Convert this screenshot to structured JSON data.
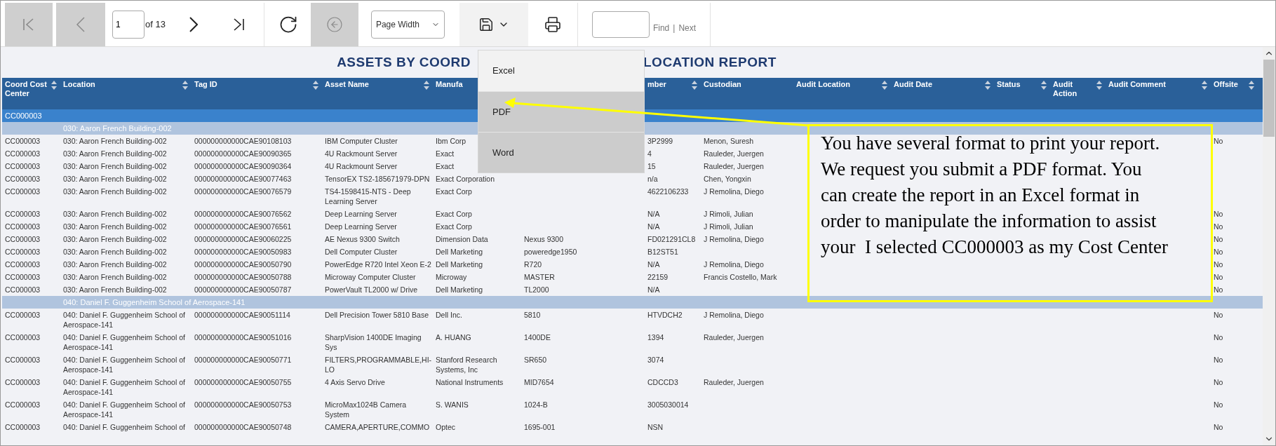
{
  "toolbar": {
    "first_page": {
      "disabled": true
    },
    "previous_page": {
      "disabled": true
    },
    "page_input": {
      "value": "1"
    },
    "page_count": "of 13",
    "next_page": {
      "disabled": false
    },
    "last_page": {
      "disabled": false
    },
    "back": {
      "disabled": true
    },
    "zoom_select": {
      "value": "Page Width"
    },
    "export": {
      "open": true
    },
    "find_link": "Find",
    "separator": "|",
    "next_link": "Next"
  },
  "export_menu": [
    {
      "label": "Excel",
      "highlighted": true
    },
    {
      "label": "PDF",
      "highlighted": false
    },
    {
      "label": "Word",
      "highlighted": false
    }
  ],
  "report_title": {
    "left_part": "ASSETS BY COORD",
    "right_part": "LOCATION REPORT"
  },
  "columns": [
    {
      "label": "Coord Cost Center",
      "sortable": true
    },
    {
      "label": "Location",
      "sortable": true
    },
    {
      "label": "Tag ID",
      "sortable": true
    },
    {
      "label": "Asset Name",
      "sortable": true
    },
    {
      "label": "Manufa",
      "sortable": false
    },
    {},
    {
      "label": "mber",
      "sortable": true
    },
    {
      "label": "Custodian",
      "sortable": false
    },
    {
      "label": "Audit Location",
      "sortable": true
    },
    {
      "label": "Audit Date",
      "sortable": true
    },
    {
      "label": "Status",
      "sortable": true
    },
    {
      "label": "Audit Action",
      "sortable": true
    },
    {
      "label": "Audit Comment",
      "sortable": true
    },
    {
      "label": "Offsite",
      "sortable": true
    }
  ],
  "rows": [
    {
      "kind": "cost_center",
      "cells": {
        "coord": "CC000003"
      }
    },
    {
      "kind": "location_group",
      "cells": {
        "location": "030: Aaron French Building-002"
      }
    },
    {
      "kind": "asset",
      "cells": {
        "coord": "CC000003",
        "location": "030: Aaron French Building-002",
        "tag_id": "000000000000CAE90108103",
        "asset_name": "IBM Computer Cluster",
        "manufacturer": "Ibm Corp",
        "column_7": "3P2999",
        "custodian": "Menon, Suresh",
        "offsite": "No"
      }
    },
    {
      "kind": "asset",
      "cells": {
        "coord": "CC000003",
        "location": "030: Aaron French Building-002",
        "tag_id": "000000000000CAE90090365",
        "asset_name": "4U Rackmount Server",
        "manufacturer": "Exact",
        "column_7": "4",
        "custodian": "Rauleder, Juergen"
      }
    },
    {
      "kind": "asset",
      "cells": {
        "coord": "CC000003",
        "location": "030: Aaron French Building-002",
        "tag_id": "000000000000CAE90090364",
        "asset_name": "4U Rackmount Server",
        "manufacturer": "Exact",
        "column_7": "15",
        "custodian": "Rauleder, Juergen"
      }
    },
    {
      "kind": "asset",
      "cells": {
        "coord": "CC000003",
        "location": "030: Aaron French Building-002",
        "tag_id": "000000000000CAE90077463",
        "asset_name": "TensorEX TS2-185671979-DPN",
        "manufacturer": "Exact Corporation",
        "column_7": "n/a",
        "custodian": "Chen, Yongxin"
      }
    },
    {
      "kind": "asset",
      "cells": {
        "coord": "CC000003",
        "location": "030: Aaron French Building-002",
        "tag_id": "000000000000CAE90076579",
        "asset_name": "TS4-1598415-NTS - Deep Learning Server",
        "manufacturer": "Exact Corp",
        "column_7": "4622106233",
        "custodian": "J Remolina, Diego"
      }
    },
    {
      "kind": "asset",
      "cells": {
        "coord": "CC000003",
        "location": "030: Aaron French Building-002",
        "tag_id": "000000000000CAE90076562",
        "asset_name": "Deep Learning Server",
        "manufacturer": "Exact Corp",
        "column_7": "N/A",
        "custodian": "J Rimoli, Julian",
        "offsite": "No"
      }
    },
    {
      "kind": "asset",
      "cells": {
        "coord": "CC000003",
        "location": "030: Aaron French Building-002",
        "tag_id": "000000000000CAE90076561",
        "asset_name": "Deep Learning Server",
        "manufacturer": "Exact Corp",
        "column_7": "N/A",
        "custodian": "J Rimoli, Julian",
        "offsite": "No"
      }
    },
    {
      "kind": "asset",
      "cells": {
        "coord": "CC000003",
        "location": "030: Aaron French Building-002",
        "tag_id": "000000000000CAE90060225",
        "asset_name": "AE Nexus 9300 Switch",
        "manufacturer": "Dimension Data",
        "column_6": "Nexus 9300",
        "column_7": "FD021291CL8",
        "custodian": "J Remolina, Diego",
        "offsite": "No"
      }
    },
    {
      "kind": "asset",
      "cells": {
        "coord": "CC000003",
        "location": "030: Aaron French Building-002",
        "tag_id": "000000000000CAE90050983",
        "asset_name": "Dell Computer Cluster",
        "manufacturer": "Dell Marketing",
        "column_6": "poweredge1950",
        "column_7": "B12ST51",
        "offsite": "No"
      }
    },
    {
      "kind": "asset",
      "cells": {
        "coord": "CC000003",
        "location": "030: Aaron French Building-002",
        "tag_id": "000000000000CAE90050790",
        "asset_name": "PowerEdge R720 Intel Xeon E-2",
        "manufacturer": "Dell Marketing",
        "column_6": "R720",
        "column_7": "N/A",
        "custodian": "J Remolina, Diego",
        "offsite": "No"
      }
    },
    {
      "kind": "asset",
      "cells": {
        "coord": "CC000003",
        "location": "030: Aaron French Building-002",
        "tag_id": "000000000000CAE90050788",
        "asset_name": "Microway Computer Cluster",
        "manufacturer": "Microway",
        "column_6": "MASTER",
        "column_7": "22159",
        "custodian": "Francis Costello, Mark",
        "offsite": "No"
      }
    },
    {
      "kind": "asset",
      "cells": {
        "coord": "CC000003",
        "location": "030: Aaron French Building-002",
        "tag_id": "000000000000CAE90050787",
        "asset_name": "PowerVault TL2000 w/ Drive",
        "manufacturer": "Dell Marketing",
        "column_6": "TL2000",
        "column_7": "N/A",
        "offsite": "No"
      }
    },
    {
      "kind": "location_group",
      "cells": {
        "location": "040: Daniel F. Guggenheim School of Aerospace-141"
      }
    },
    {
      "kind": "asset",
      "cells": {
        "coord": "CC000003",
        "location": "040: Daniel F. Guggenheim School of Aerospace-141",
        "tag_id": "000000000000CAE90051114",
        "asset_name": "Dell Precision Tower 5810 Base",
        "manufacturer": "Dell Inc.",
        "column_6": "5810",
        "column_7": "HTVDCH2",
        "custodian": "J Remolina, Diego",
        "offsite": "No"
      }
    },
    {
      "kind": "asset",
      "cells": {
        "coord": "CC000003",
        "location": "040: Daniel F. Guggenheim School of Aerospace-141",
        "tag_id": "000000000000CAE90051016",
        "asset_name": "SharpVision 1400DE Imaging Sys",
        "manufacturer": "A. HUANG",
        "column_6": "1400DE",
        "column_7": "1394",
        "custodian": "Rauleder, Juergen",
        "offsite": "No"
      }
    },
    {
      "kind": "asset",
      "cells": {
        "coord": "CC000003",
        "location": "040: Daniel F. Guggenheim School of Aerospace-141",
        "tag_id": "000000000000CAE90050771",
        "asset_name": "FILTERS,PROGRAMMABLE,HI-LO",
        "manufacturer": "Stanford Research Systems, Inc",
        "column_6": "SR650",
        "column_7": "3074",
        "offsite": "No"
      }
    },
    {
      "kind": "asset",
      "cells": {
        "coord": "CC000003",
        "location": "040: Daniel F. Guggenheim School of Aerospace-141",
        "tag_id": "000000000000CAE90050755",
        "asset_name": "4 Axis Servo Drive",
        "manufacturer": "National Instruments",
        "column_6": "MID7654",
        "column_7": "CDCCD3",
        "custodian": "Rauleder, Juergen",
        "offsite": "No"
      }
    },
    {
      "kind": "asset",
      "cells": {
        "coord": "CC000003",
        "location": "040: Daniel F. Guggenheim School of Aerospace-141",
        "tag_id": "000000000000CAE90050753",
        "asset_name": "MicroMax1024B Camera System",
        "manufacturer": "S. WANIS",
        "column_6": "1024-B",
        "column_7": "3005030014",
        "offsite": "No"
      }
    },
    {
      "kind": "asset",
      "cells": {
        "coord": "CC000003",
        "location": "040: Daniel F. Guggenheim School of",
        "tag_id": "000000000000CAE90050748",
        "asset_name": "CAMERA,APERTURE,COMMO",
        "manufacturer": "Optec",
        "column_6": "1695-001",
        "column_7": "NSN",
        "offsite": "No"
      }
    }
  ],
  "callout": {
    "text": "You have several format to print your report. We request you submit a PDF format. You can create the report in an Excel format in order to manipulate the information to assist your  I selected CC000003 as my Cost Center"
  }
}
